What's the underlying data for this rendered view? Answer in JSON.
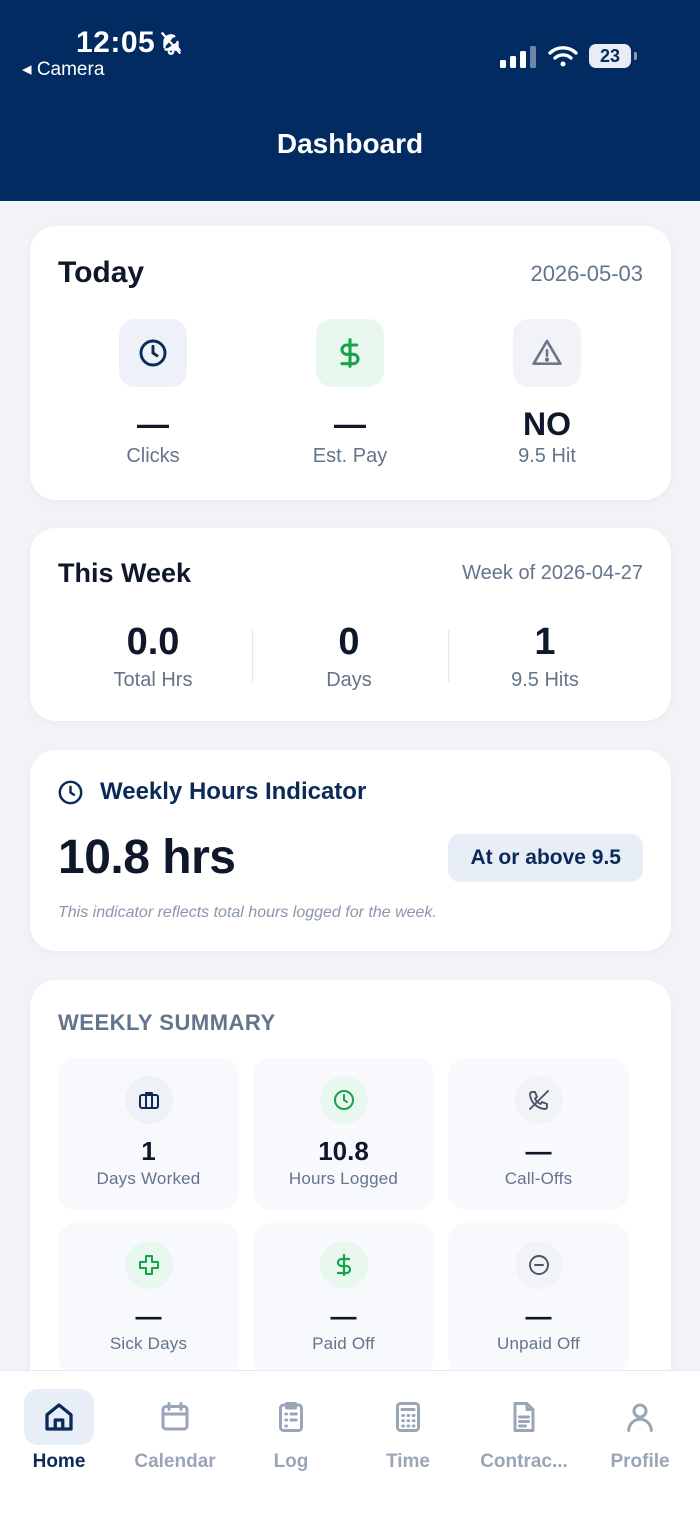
{
  "status_bar": {
    "time": "12:05",
    "back_label": "◂ Camera",
    "battery": "23"
  },
  "header": {
    "title": "Dashboard"
  },
  "today": {
    "title": "Today",
    "date": "2026-05-03",
    "stats": [
      {
        "icon": "clock-icon",
        "value": "—",
        "label": "Clicks"
      },
      {
        "icon": "dollar-icon",
        "value": "—",
        "label": "Est. Pay"
      },
      {
        "icon": "warning-icon",
        "value": "NO",
        "label": "9.5 Hit"
      }
    ]
  },
  "week": {
    "title": "This Week",
    "subtitle": "Week of 2026-04-27",
    "stats": [
      {
        "value": "0.0",
        "label": "Total Hrs"
      },
      {
        "value": "0",
        "label": "Days"
      },
      {
        "value": "1",
        "label": "9.5 Hits"
      }
    ]
  },
  "indicator": {
    "title": "Weekly Hours Indicator",
    "value": "10.8 hrs",
    "badge": "At or above 9.5",
    "note": "This indicator reflects total hours logged for the week."
  },
  "summary": {
    "title": "WEEKLY SUMMARY",
    "tiles": [
      {
        "icon": "briefcase-icon",
        "value": "1",
        "label": "Days Worked"
      },
      {
        "icon": "clock-icon",
        "value": "10.8",
        "label": "Hours Logged"
      },
      {
        "icon": "phone-off-icon",
        "value": "—",
        "label": "Call-Offs"
      },
      {
        "icon": "plus-icon",
        "value": "—",
        "label": "Sick Days"
      },
      {
        "icon": "dollar-icon",
        "value": "—",
        "label": "Paid Off"
      },
      {
        "icon": "minus-circle-icon",
        "value": "—",
        "label": "Unpaid Off"
      }
    ]
  },
  "tabs": [
    {
      "label": "Home",
      "icon": "home-icon",
      "active": true
    },
    {
      "label": "Calendar",
      "icon": "calendar-icon",
      "active": false
    },
    {
      "label": "Log",
      "icon": "clipboard-icon",
      "active": false
    },
    {
      "label": "Time",
      "icon": "calculator-icon",
      "active": false
    },
    {
      "label": "Contrac...",
      "icon": "document-icon",
      "active": false
    },
    {
      "label": "Profile",
      "icon": "user-icon",
      "active": false
    }
  ],
  "colors": {
    "header_bg": "#022b61",
    "accent_navy": "#0b2a57",
    "green": "#16a34a",
    "muted": "#64748b",
    "page_bg": "#f1f3f7"
  }
}
